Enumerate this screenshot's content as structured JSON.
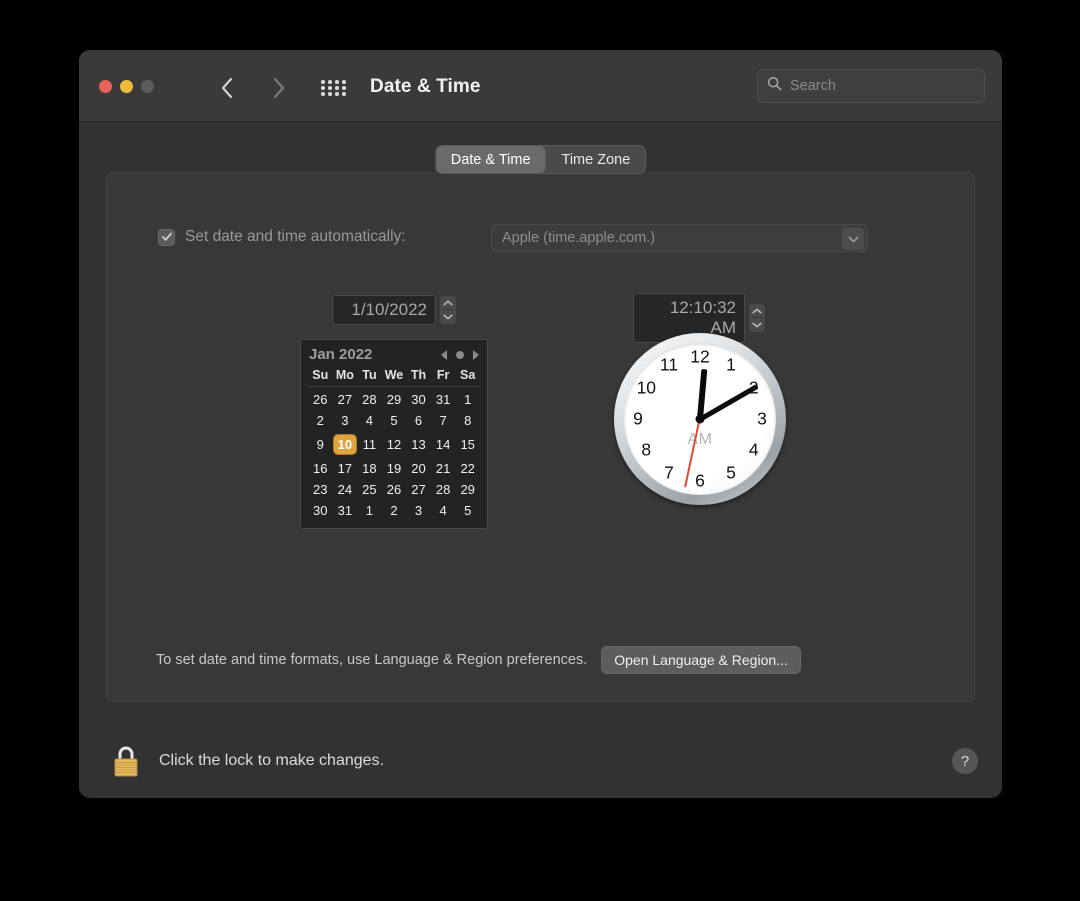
{
  "window": {
    "title": "Date & Time",
    "traffic_lights": [
      {
        "name": "close",
        "color": "#e8615a"
      },
      {
        "name": "minimize",
        "color": "#eebb3a"
      },
      {
        "name": "zoom",
        "color": "#5c5c5c"
      }
    ]
  },
  "toolbar": {
    "back_icon": "chevron-left-icon",
    "forward_icon": "chevron-right-icon",
    "grid_icon": "grid-apps-icon",
    "search": {
      "placeholder": "Search",
      "value": "",
      "icon": "search-icon"
    }
  },
  "tabs": [
    {
      "label": "Date & Time",
      "selected": true
    },
    {
      "label": "Time Zone",
      "selected": false
    }
  ],
  "auto_row": {
    "checkbox_label": "Set date and time automatically:",
    "checked": true,
    "disabled": true,
    "check_glyph": "✓",
    "server_value": "Apple (time.apple.com.)",
    "chevron_icon": "chevron-down-icon"
  },
  "date_field": {
    "value": "1/10/2022",
    "stepper_up_icon": "chevron-up-icon",
    "stepper_down_icon": "chevron-down-icon"
  },
  "time_field": {
    "value": "12:10:32 AM",
    "stepper_up_icon": "chevron-up-icon",
    "stepper_down_icon": "chevron-down-icon"
  },
  "calendar": {
    "month_label": "Jan 2022",
    "prev_icon": "triangle-left-icon",
    "today_icon": "circle-dot-icon",
    "next_icon": "triangle-right-icon",
    "weekdays": [
      "Su",
      "Mo",
      "Tu",
      "We",
      "Th",
      "Fr",
      "Sa"
    ],
    "selected_day": 10,
    "highlight_color": "#e0a33e",
    "weeks": [
      [
        {
          "d": "26",
          "dim": true
        },
        {
          "d": "27",
          "dim": true
        },
        {
          "d": "28",
          "dim": true
        },
        {
          "d": "29",
          "dim": true
        },
        {
          "d": "30",
          "dim": true
        },
        {
          "d": "31",
          "dim": true
        },
        {
          "d": "1",
          "dim": false
        }
      ],
      [
        {
          "d": "2",
          "dim": false
        },
        {
          "d": "3",
          "dim": false
        },
        {
          "d": "4",
          "dim": false
        },
        {
          "d": "5",
          "dim": false
        },
        {
          "d": "6",
          "dim": false
        },
        {
          "d": "7",
          "dim": false
        },
        {
          "d": "8",
          "dim": false
        }
      ],
      [
        {
          "d": "9",
          "dim": false
        },
        {
          "d": "10",
          "dim": false,
          "sel": true
        },
        {
          "d": "11",
          "dim": false
        },
        {
          "d": "12",
          "dim": false
        },
        {
          "d": "13",
          "dim": false
        },
        {
          "d": "14",
          "dim": false
        },
        {
          "d": "15",
          "dim": false
        }
      ],
      [
        {
          "d": "16",
          "dim": false
        },
        {
          "d": "17",
          "dim": false
        },
        {
          "d": "18",
          "dim": false
        },
        {
          "d": "19",
          "dim": false
        },
        {
          "d": "20",
          "dim": false
        },
        {
          "d": "21",
          "dim": false
        },
        {
          "d": "22",
          "dim": false
        }
      ],
      [
        {
          "d": "23",
          "dim": false
        },
        {
          "d": "24",
          "dim": false
        },
        {
          "d": "25",
          "dim": false
        },
        {
          "d": "26",
          "dim": false
        },
        {
          "d": "27",
          "dim": false
        },
        {
          "d": "28",
          "dim": false
        },
        {
          "d": "29",
          "dim": false
        }
      ],
      [
        {
          "d": "30",
          "dim": false
        },
        {
          "d": "31",
          "dim": false
        },
        {
          "d": "1",
          "dim": true
        },
        {
          "d": "2",
          "dim": true
        },
        {
          "d": "3",
          "dim": true
        },
        {
          "d": "4",
          "dim": true
        },
        {
          "d": "5",
          "dim": true
        }
      ]
    ]
  },
  "clock": {
    "numerals": [
      "12",
      "1",
      "2",
      "3",
      "4",
      "5",
      "6",
      "7",
      "8",
      "9",
      "10",
      "11"
    ],
    "ampm": "AM",
    "hour": 12,
    "minute": 10,
    "second": 32,
    "hour_angle": 5,
    "minute_angle": 60,
    "second_angle": 192,
    "second_hand_color": "#e8462f"
  },
  "format_row": {
    "note": "To set date and time formats, use Language & Region preferences.",
    "button_label": "Open Language & Region..."
  },
  "lock_row": {
    "icon": "lock-closed-icon",
    "text": "Click the lock to make changes."
  },
  "help": {
    "label": "?",
    "icon": "question-mark-icon"
  }
}
